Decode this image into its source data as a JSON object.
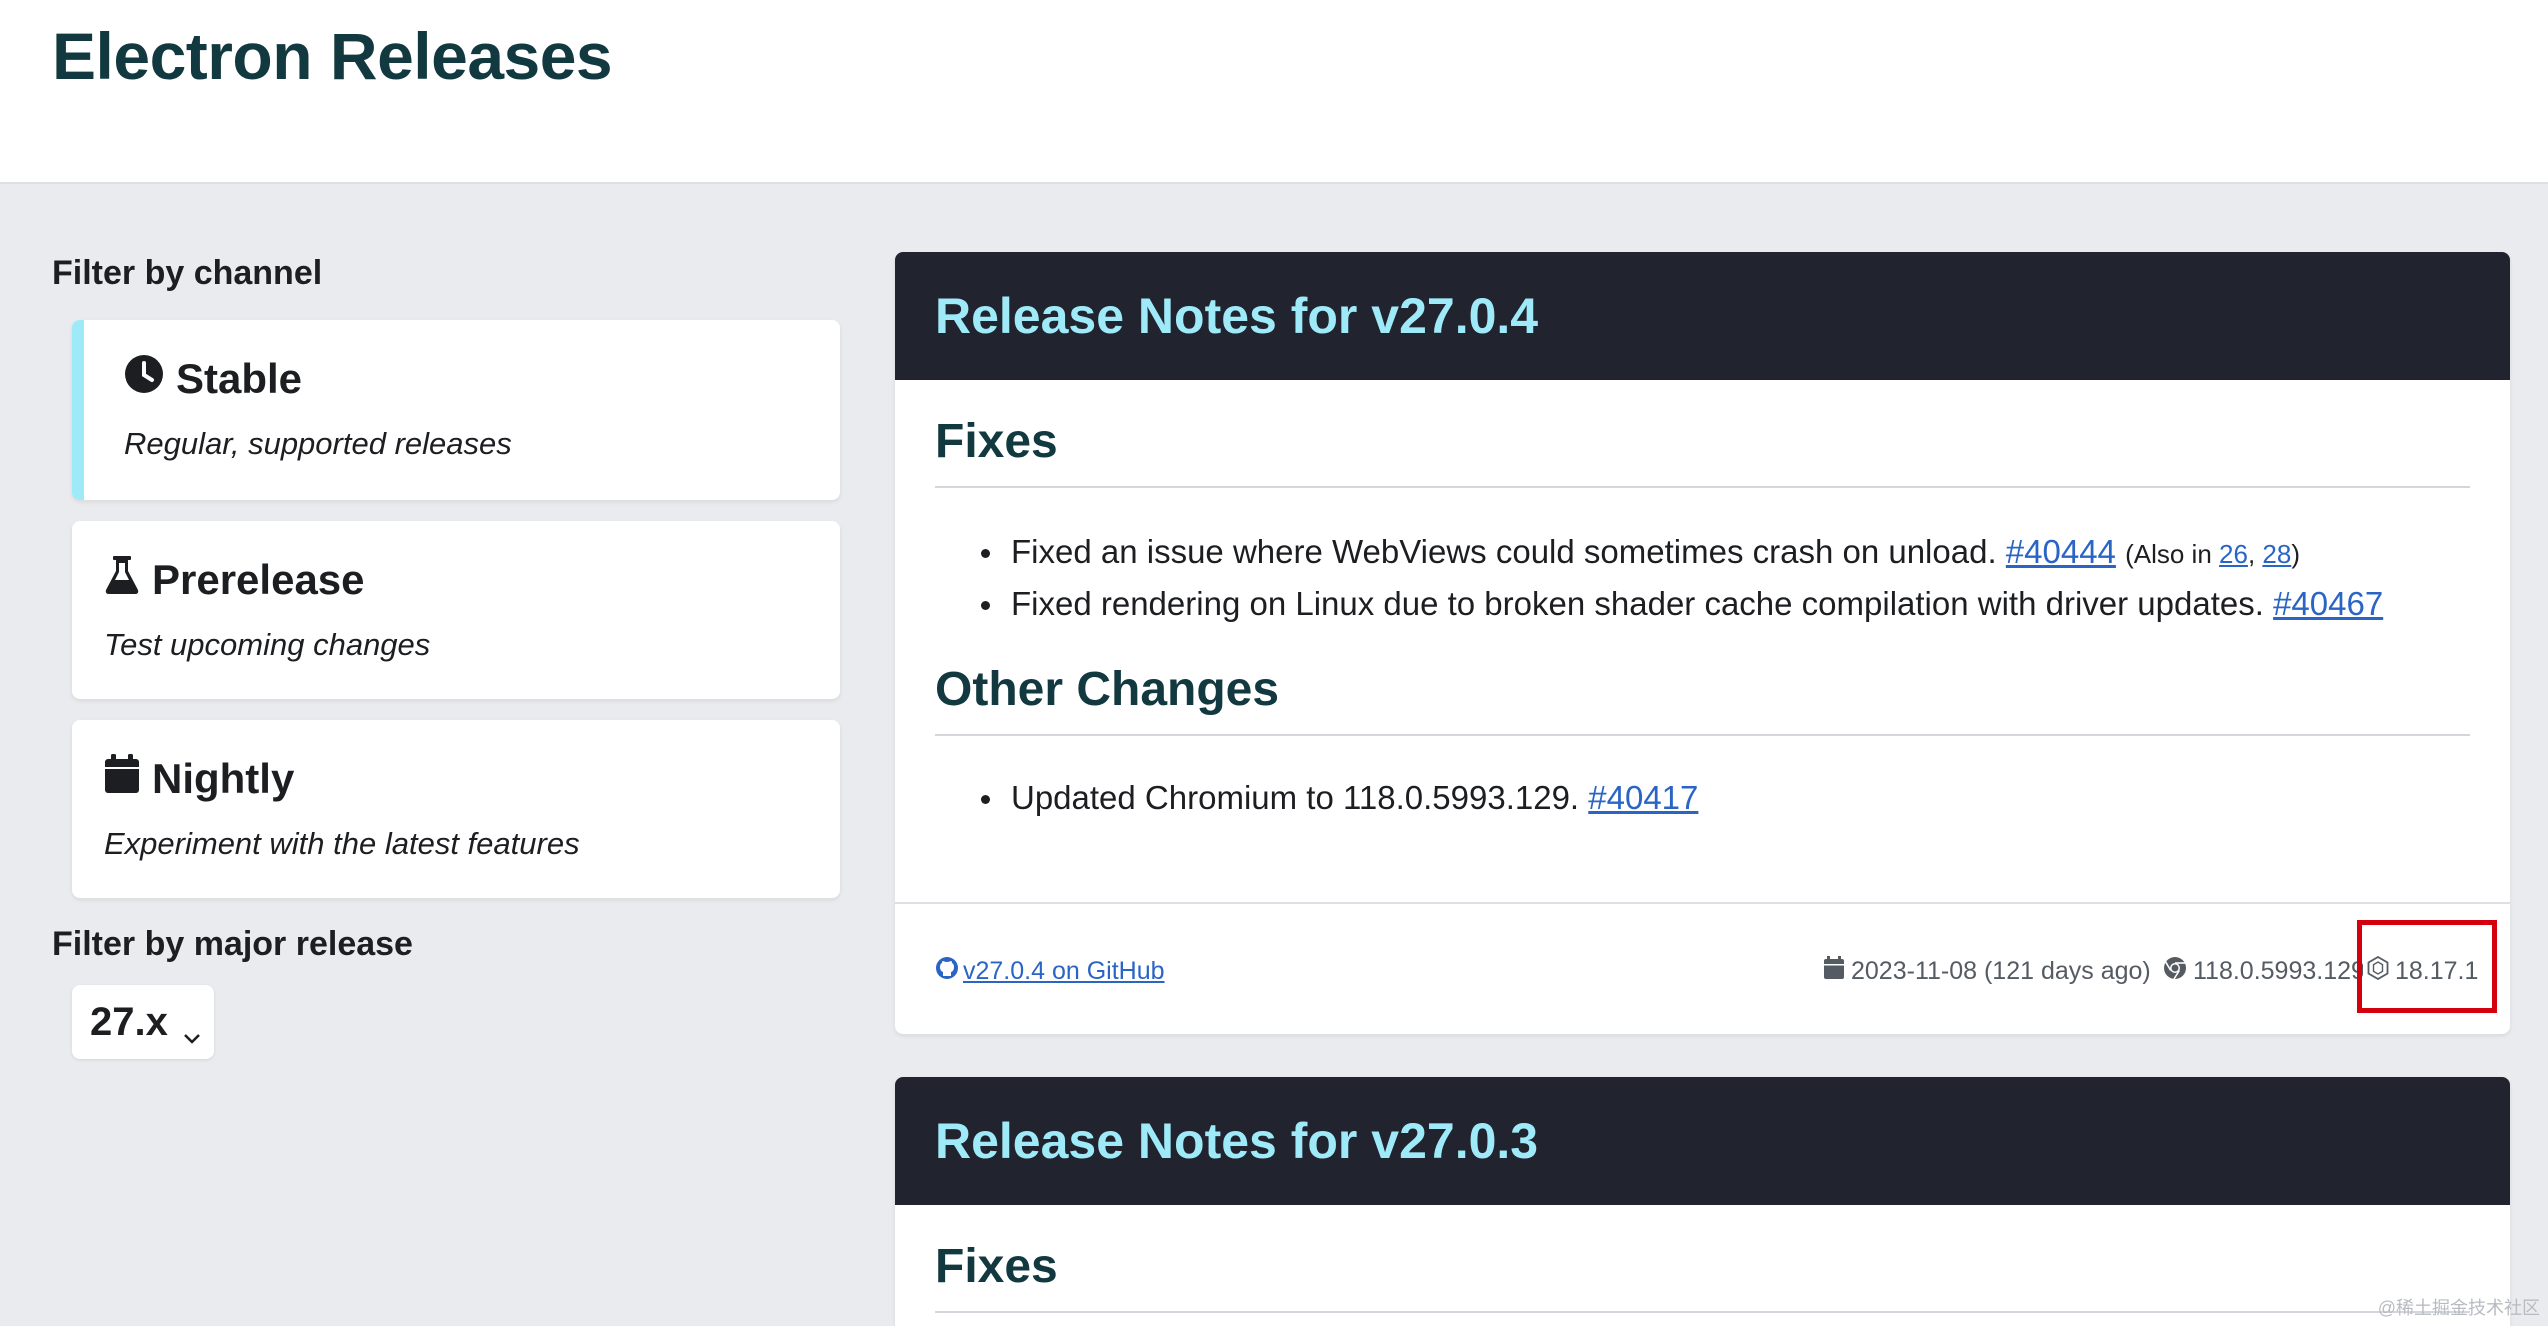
{
  "header": {
    "title": "Electron Releases"
  },
  "sidebar": {
    "channel_heading": "Filter by channel",
    "channels": [
      {
        "label": "Stable",
        "description": "Regular, supported releases",
        "icon": "clock-icon",
        "active": true
      },
      {
        "label": "Prerelease",
        "description": "Test upcoming changes",
        "icon": "flask-icon",
        "active": false
      },
      {
        "label": "Nightly",
        "description": "Experiment with the latest features",
        "icon": "calendar-icon",
        "active": false
      }
    ],
    "major_heading": "Filter by major release",
    "major_value": "27.x"
  },
  "releases": [
    {
      "title": "Release Notes for v27.0.4",
      "sections": [
        {
          "title": "Fixes",
          "items": [
            {
              "text": "Fixed an issue where WebViews could sometimes crash on unload.",
              "pr": "#40444",
              "also_prefix": "(Also in",
              "also": [
                "26",
                "28"
              ],
              "also_suffix": ")"
            },
            {
              "text": "Fixed rendering on Linux due to broken shader cache compilation with driver updates.",
              "pr": "#40467"
            }
          ]
        },
        {
          "title": "Other Changes",
          "items": [
            {
              "text": "Updated Chromium to 118.0.5993.129.",
              "pr": "#40417"
            }
          ]
        }
      ],
      "footer": {
        "github_link": "v27.0.4 on GitHub",
        "date": "2023-11-08 (121 days ago)",
        "chrome_version": "118.0.5993.129",
        "node_version": "18.17.1"
      }
    },
    {
      "title": "Release Notes for v27.0.3",
      "sections": [
        {
          "title": "Fixes"
        }
      ]
    }
  ],
  "watermark": "@稀土掘金技术社区",
  "colors": {
    "accent_cyan": "#9feaf9",
    "card_header_bg": "#21232e",
    "heading_teal": "#12393f",
    "link_blue": "#2a64c5",
    "highlight_red": "#d4000d"
  }
}
